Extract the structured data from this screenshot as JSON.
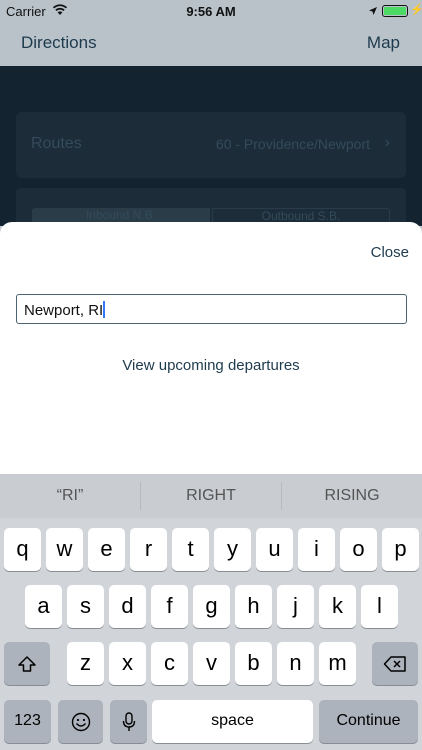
{
  "status_bar": {
    "carrier": "Carrier",
    "time": "9:56 AM",
    "battery_level": 1.0
  },
  "nav": {
    "left_label": "Directions",
    "right_label": "Map"
  },
  "background": {
    "route_label": "Routes",
    "route_value": "60 - Providence/Newport",
    "segments": [
      "Inbound N.B.",
      "Outbound S.B."
    ]
  },
  "sheet": {
    "close_label": "Close",
    "search_value": "Newport, RI",
    "link_label": "View upcoming departures"
  },
  "keyboard": {
    "suggestions": [
      "“RI”",
      "RIGHT",
      "RISING"
    ],
    "row1": [
      "q",
      "w",
      "e",
      "r",
      "t",
      "y",
      "u",
      "i",
      "o",
      "p"
    ],
    "row2": [
      "a",
      "s",
      "d",
      "f",
      "g",
      "h",
      "j",
      "k",
      "l"
    ],
    "row3": [
      "z",
      "x",
      "c",
      "v",
      "b",
      "n",
      "m"
    ],
    "numbers_label": "123",
    "space_label": "space",
    "return_label": "Continue"
  }
}
